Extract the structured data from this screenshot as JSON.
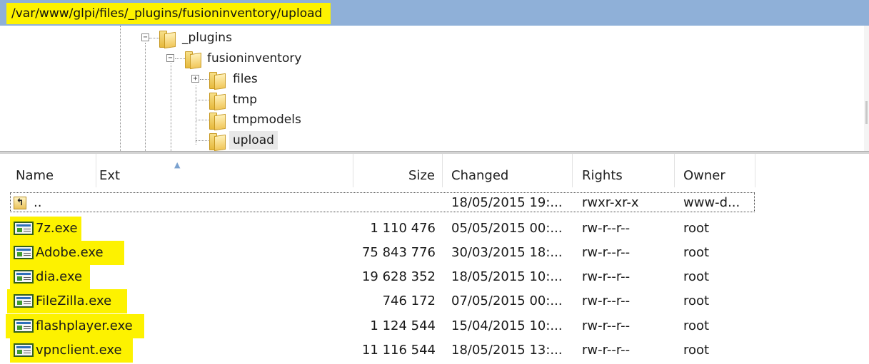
{
  "path_bar": {
    "path": "/var/www/glpi/files/_plugins/fusioninventory/upload"
  },
  "tree": {
    "items": [
      {
        "label": "_plugins",
        "expander": "−"
      },
      {
        "label": "fusioninventory",
        "expander": "−"
      },
      {
        "label": "files",
        "expander": "+"
      },
      {
        "label": "tmp"
      },
      {
        "label": "tmpmodels"
      },
      {
        "label": "upload"
      }
    ]
  },
  "list": {
    "columns": {
      "name": "Name",
      "ext": "Ext",
      "size": "Size",
      "changed": "Changed",
      "rights": "Rights",
      "owner": "Owner"
    },
    "parent_row": {
      "name": "..",
      "changed": "18/05/2015 19:...",
      "rights": "rwxr-xr-x",
      "owner": "www-d..."
    },
    "rows": [
      {
        "name": "7z.exe",
        "size": "1 110 476",
        "changed": "05/05/2015 00:...",
        "rights": "rw-r--r--",
        "owner": "root"
      },
      {
        "name": "Adobe.exe",
        "size": "75 843 776",
        "changed": "30/03/2015 18:...",
        "rights": "rw-r--r--",
        "owner": "root"
      },
      {
        "name": "dia.exe",
        "size": "19 628 352",
        "changed": "18/05/2015 10:...",
        "rights": "rw-r--r--",
        "owner": "root"
      },
      {
        "name": "FileZilla.exe",
        "size": "746 172",
        "changed": "07/05/2015 00:...",
        "rights": "rw-r--r--",
        "owner": "root"
      },
      {
        "name": "flashplayer.exe",
        "size": "1 124 544",
        "changed": "15/04/2015 10:...",
        "rights": "rw-r--r--",
        "owner": "root"
      },
      {
        "name": "vpnclient.exe",
        "size": "11 116 544",
        "changed": "18/05/2015 13:...",
        "rights": "rw-r--r--",
        "owner": "root"
      }
    ]
  },
  "colors": {
    "highlight": "#fdf200",
    "path_bar": "#8fb0d8",
    "selection": "#e8e8e8"
  },
  "icons": {
    "folder": "folder-icon",
    "exe": "exe-file-icon",
    "parent": "parent-dir-icon",
    "sort": "sort-ascending-icon"
  }
}
